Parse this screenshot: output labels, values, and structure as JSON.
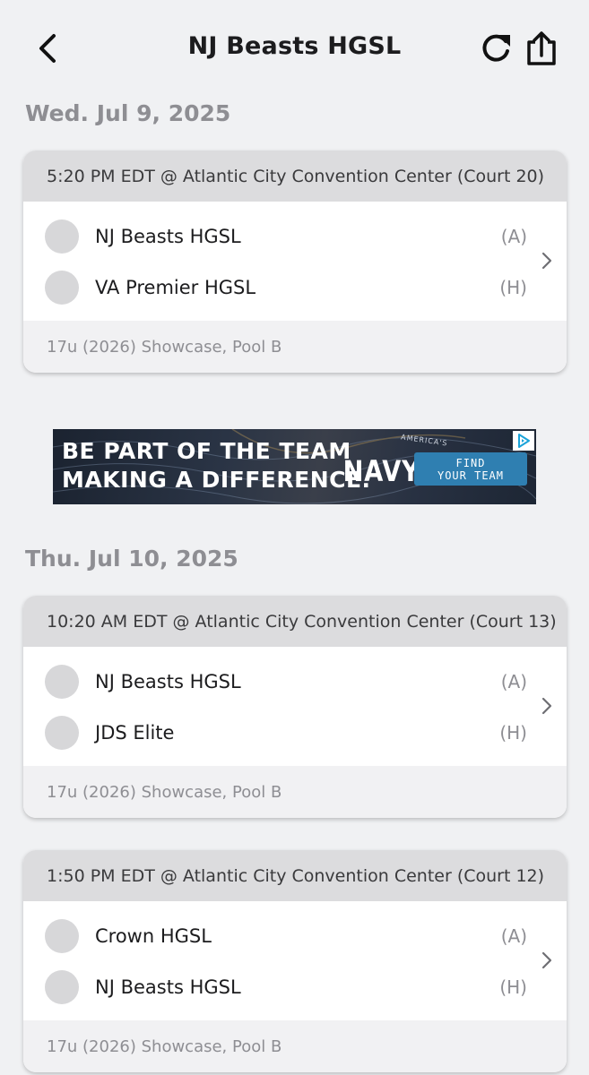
{
  "header": {
    "title": "NJ Beasts HGSL"
  },
  "days": [
    {
      "date": "Wed. Jul 9, 2025",
      "games": [
        {
          "header": "5:20 PM EDT @ Atlantic City Convention Center (Court 20)",
          "team1": {
            "name": "NJ Beasts HGSL",
            "side": "(A)"
          },
          "team2": {
            "name": "VA Premier HGSL",
            "side": "(H)"
          },
          "footer": "17u (2026) Showcase, Pool B"
        }
      ]
    },
    {
      "date": "Thu. Jul 10, 2025",
      "games": [
        {
          "header": "10:20 AM EDT @ Atlantic City Convention Center (Court 13)",
          "team1": {
            "name": "NJ Beasts HGSL",
            "side": "(A)"
          },
          "team2": {
            "name": "JDS Elite",
            "side": "(H)"
          },
          "footer": "17u (2026) Showcase, Pool B"
        },
        {
          "header": "1:50 PM EDT @ Atlantic City Convention Center (Court 12)",
          "team1": {
            "name": "Crown HGSL",
            "side": "(A)"
          },
          "team2": {
            "name": "NJ Beasts HGSL",
            "side": "(H)"
          },
          "footer": "17u (2026) Showcase, Pool B"
        }
      ]
    }
  ],
  "ad": {
    "line1": "BE PART OF THE TEAM",
    "line2": "MAKING A DIFFERENCE.",
    "brand_small": "AMERICA'S",
    "brand": "NAVY",
    "cta_line1": "FIND",
    "cta_line2": "YOUR TEAM"
  },
  "icons": {
    "back": "chevron-left-icon",
    "refresh": "refresh-icon",
    "share": "share-icon",
    "chevron": "chevron-right-icon",
    "ad_choices": "ad-choices-icon"
  },
  "colors": {
    "background": "#f0f1f3",
    "card_header": "#dcdcde",
    "muted_text": "#8e8e93",
    "ad_cta": "#2f7fb1"
  }
}
